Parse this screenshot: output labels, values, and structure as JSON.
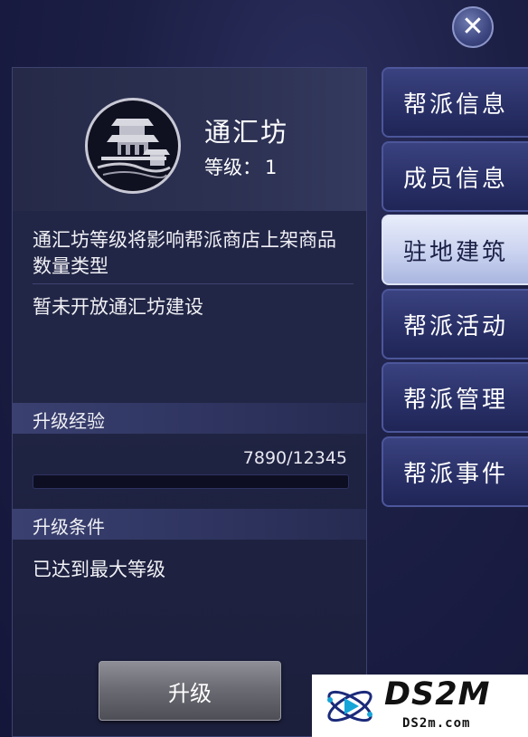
{
  "close_icon": "close-icon",
  "building": {
    "name": "通汇坊",
    "level_label": "等级：",
    "level_value": "1",
    "description": "通汇坊等级将影响帮派商店上架商品数量类型",
    "status": "暂未开放通汇坊建设"
  },
  "experience": {
    "section_title": "升级经验",
    "current": 7890,
    "max": 12345,
    "text": "7890/12345",
    "progress_fraction": 0.0
  },
  "conditions": {
    "section_title": "升级条件",
    "text": "已达到最大等级"
  },
  "upgrade_button": {
    "label": "升级"
  },
  "tabs": [
    {
      "label": "帮派信息",
      "active": false
    },
    {
      "label": "成员信息",
      "active": false
    },
    {
      "label": "驻地建筑",
      "active": true
    },
    {
      "label": "帮派活动",
      "active": false
    },
    {
      "label": "帮派管理",
      "active": false
    },
    {
      "label": "帮派事件",
      "active": false
    }
  ],
  "watermark": {
    "main": "DS2M",
    "sub": "DS2m.com"
  },
  "colors": {
    "active_tab": "#c9d2ef",
    "tab": "#2a3168",
    "panel": "#222646"
  }
}
